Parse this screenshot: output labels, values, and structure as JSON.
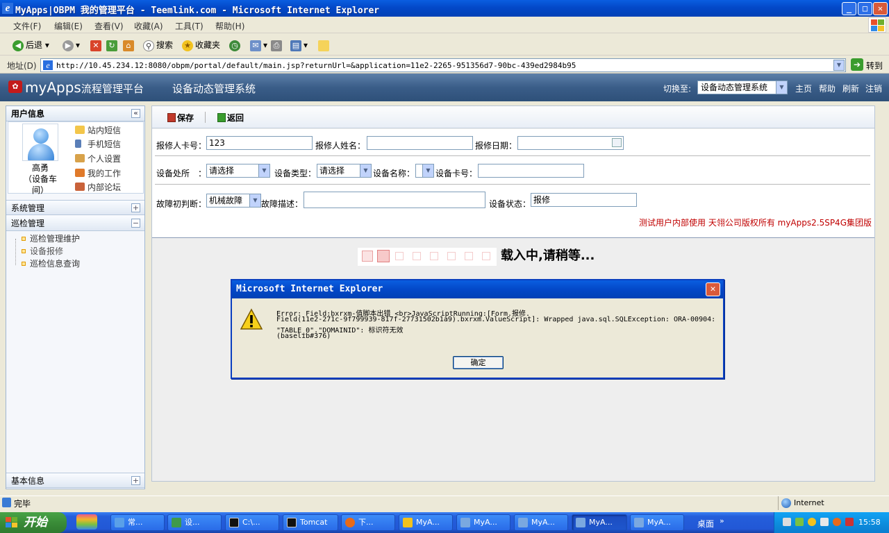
{
  "window": {
    "title": "MyApps|OBPM 我的管理平台 - Teemlink.com - Microsoft Internet Explorer",
    "minimize": "_",
    "maximize": "□",
    "close": "✕"
  },
  "menu": [
    "文件(F)",
    "编辑(E)",
    "查看(V)",
    "收藏(A)",
    "工具(T)",
    "帮助(H)"
  ],
  "toolbar": {
    "back": "后退",
    "search": "搜索",
    "favorites": "收藏夹"
  },
  "address": {
    "label": "地址(D)",
    "url": "http://10.45.234.12:8080/obpm/portal/default/main.jsp?returnUrl=&application=11e2-2265-951356d7-90bc-439ed2984b95",
    "go": "转到"
  },
  "app": {
    "logo_main": "myApps",
    "logo_sub": "流程管理平台",
    "system_title": "设备动态管理系统",
    "switch_label": "切换至:",
    "switch_value": "设备动态管理系统",
    "links": [
      "主页",
      "帮助",
      "刷新",
      "注销"
    ]
  },
  "sidebar": {
    "user_header": "用户信息",
    "user_name_1": "高勇",
    "user_name_2": "（设备车",
    "user_name_3": "间）",
    "user_links": [
      "站内短信",
      "手机短信",
      "个人设置",
      "我的工作",
      "内部论坛"
    ],
    "sections": {
      "system": "系统管理",
      "inspection": "巡检管理",
      "basic": "基本信息"
    },
    "tree_items": [
      "巡检管理维护",
      "设备报修",
      "巡检信息查询"
    ],
    "collapse": "«",
    "plus": "+",
    "minus": "−"
  },
  "form": {
    "save": "保存",
    "back": "返回",
    "card_label": "报修人卡号：",
    "card_value": "123",
    "name_label": "报修人姓名：",
    "name_value": "",
    "date_label": "报修日期：",
    "date_value": "",
    "location_label": "设备处所　：",
    "location_value": "请选择",
    "type_label": "设备类型：",
    "type_value": "请选择",
    "equip_name_label": "设备名称：",
    "equip_name_value": "",
    "equip_card_label": "设备卡号：",
    "equip_card_value": "",
    "fault_label": "故障初判断：",
    "fault_value": "机械故障",
    "fault_desc_label": "故障描述：",
    "fault_desc_value": "",
    "status_label": "设备状态：",
    "status_value": "报修"
  },
  "copyright": "测试用户内部使用  天翎公司版权所有  myApps2.5SP4G集团版",
  "loading_text": "载入中,请稍等...",
  "dialog": {
    "title": "Microsoft Internet Explorer",
    "line1": "Error: Field:bxrxm-值脚本出错 <br>JavaScriptRunning:[Form.报修.",
    "line2": "Field(11e2-271c-9f799939-817f-27731502b1a9).bxrxm.ValueScript]: Wrapped java.sql.SQLException: ORA-00904:",
    "line3": "\"TABLE_0\".\"DOMAINID\": 标识符无效",
    "line4": " (baselib#376)",
    "ok": "确定"
  },
  "status": {
    "text": "完毕",
    "zone": "Internet"
  },
  "taskbar": {
    "start": "开始",
    "tasks": [
      "常...",
      "设...",
      "C:\\...",
      "Tomcat",
      "下...",
      "MyA...",
      "MyA...",
      "MyA...",
      "MyA...",
      "MyA..."
    ],
    "desktop": "桌面",
    "clock": "15:58"
  },
  "colors": {
    "xp_blue": "#0348c8",
    "header_blue": "#3a5d88",
    "copyright_red": "#c00000",
    "start_green": "#3a8c38"
  }
}
